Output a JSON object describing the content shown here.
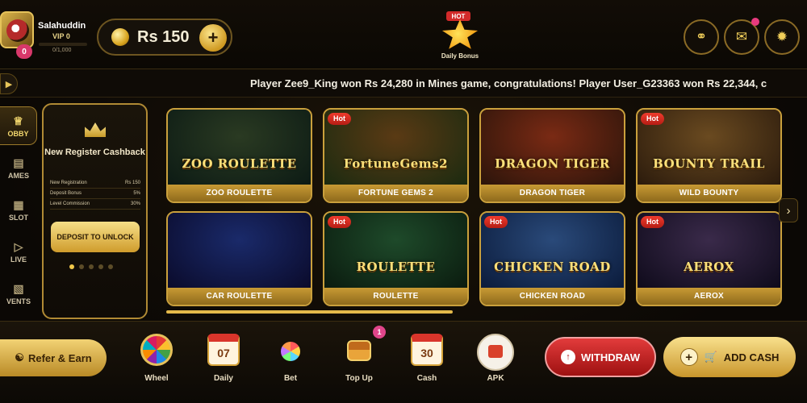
{
  "user": {
    "name": "Salahuddin",
    "vip": "VIP 0",
    "vip_progress": "0/1,000",
    "notification_count": "0"
  },
  "balance": {
    "amount": "Rs 150"
  },
  "daily_bonus": {
    "tag": "HOT",
    "label": "Daily Bonus"
  },
  "ticker": {
    "text": "Player Zee9_King won Rs 24,280 in Mines game, congratulations! Player User_G23363 won Rs 22,344, c"
  },
  "sidebar": {
    "items": [
      {
        "label": "OBBY",
        "icon": "crown-icon"
      },
      {
        "label": "AMES",
        "icon": "cards-icon"
      },
      {
        "label": "SLOT",
        "icon": "slot-icon"
      },
      {
        "label": "LIVE",
        "icon": "play-icon"
      },
      {
        "label": "VENTS",
        "icon": "calendar-icon"
      }
    ]
  },
  "promo": {
    "title": "New Register Cashback",
    "rows": [
      {
        "name": "New Registration",
        "value": "Rs 150"
      },
      {
        "name": "Deposit Bonus",
        "value": "5%"
      },
      {
        "name": "Level Commission",
        "value": "30%"
      }
    ],
    "button": "DEPOSIT TO UNLOCK"
  },
  "games": [
    {
      "label": "ZOO ROULETTE",
      "art_title": "ZOO ROULETTE",
      "hot": "",
      "colors": [
        "#2a3a22",
        "#0c1a14"
      ]
    },
    {
      "label": "FORTUNE GEMS 2",
      "art_title": "FortuneGems2",
      "hot": "Hot",
      "colors": [
        "#5a3a14",
        "#1a2a10"
      ]
    },
    {
      "label": "DRAGON TIGER",
      "art_title": "DRAGON TIGER",
      "hot": "",
      "colors": [
        "#7a2a14",
        "#2a140a"
      ]
    },
    {
      "label": "WILD BOUNTY",
      "art_title": "BOUNTY TRAIL",
      "hot": "Hot",
      "colors": [
        "#6a4a20",
        "#2a1a0c"
      ]
    },
    {
      "label": "CAR ROULETTE",
      "art_title": "",
      "hot": "",
      "colors": [
        "#1a2a6a",
        "#0a0a2a"
      ]
    },
    {
      "label": "ROULETTE",
      "art_title": "ROULETTE",
      "hot": "Hot",
      "colors": [
        "#1e4a2a",
        "#0a1a0e"
      ]
    },
    {
      "label": "CHICKEN ROAD",
      "art_title": "CHICKEN ROAD",
      "hot": "Hot",
      "colors": [
        "#2a4a7a",
        "#0a1a3a"
      ]
    },
    {
      "label": "AEROX",
      "art_title": "AEROX",
      "hot": "Hot",
      "colors": [
        "#3a2a4a",
        "#0e0a1a"
      ]
    }
  ],
  "bottom": {
    "refer": "Refer & Earn",
    "items": [
      {
        "label": "Wheel"
      },
      {
        "label": "Daily",
        "value": "07"
      },
      {
        "label": "Bet"
      },
      {
        "label": "Top Up",
        "badge": "1"
      },
      {
        "label": "Cash",
        "value": "30"
      },
      {
        "label": "APK"
      }
    ],
    "withdraw": "WITHDRAW",
    "add_cash": "ADD CASH"
  },
  "colors": {
    "gold": "#caa03c",
    "red": "#d22a2a",
    "background": "#0a0806"
  }
}
